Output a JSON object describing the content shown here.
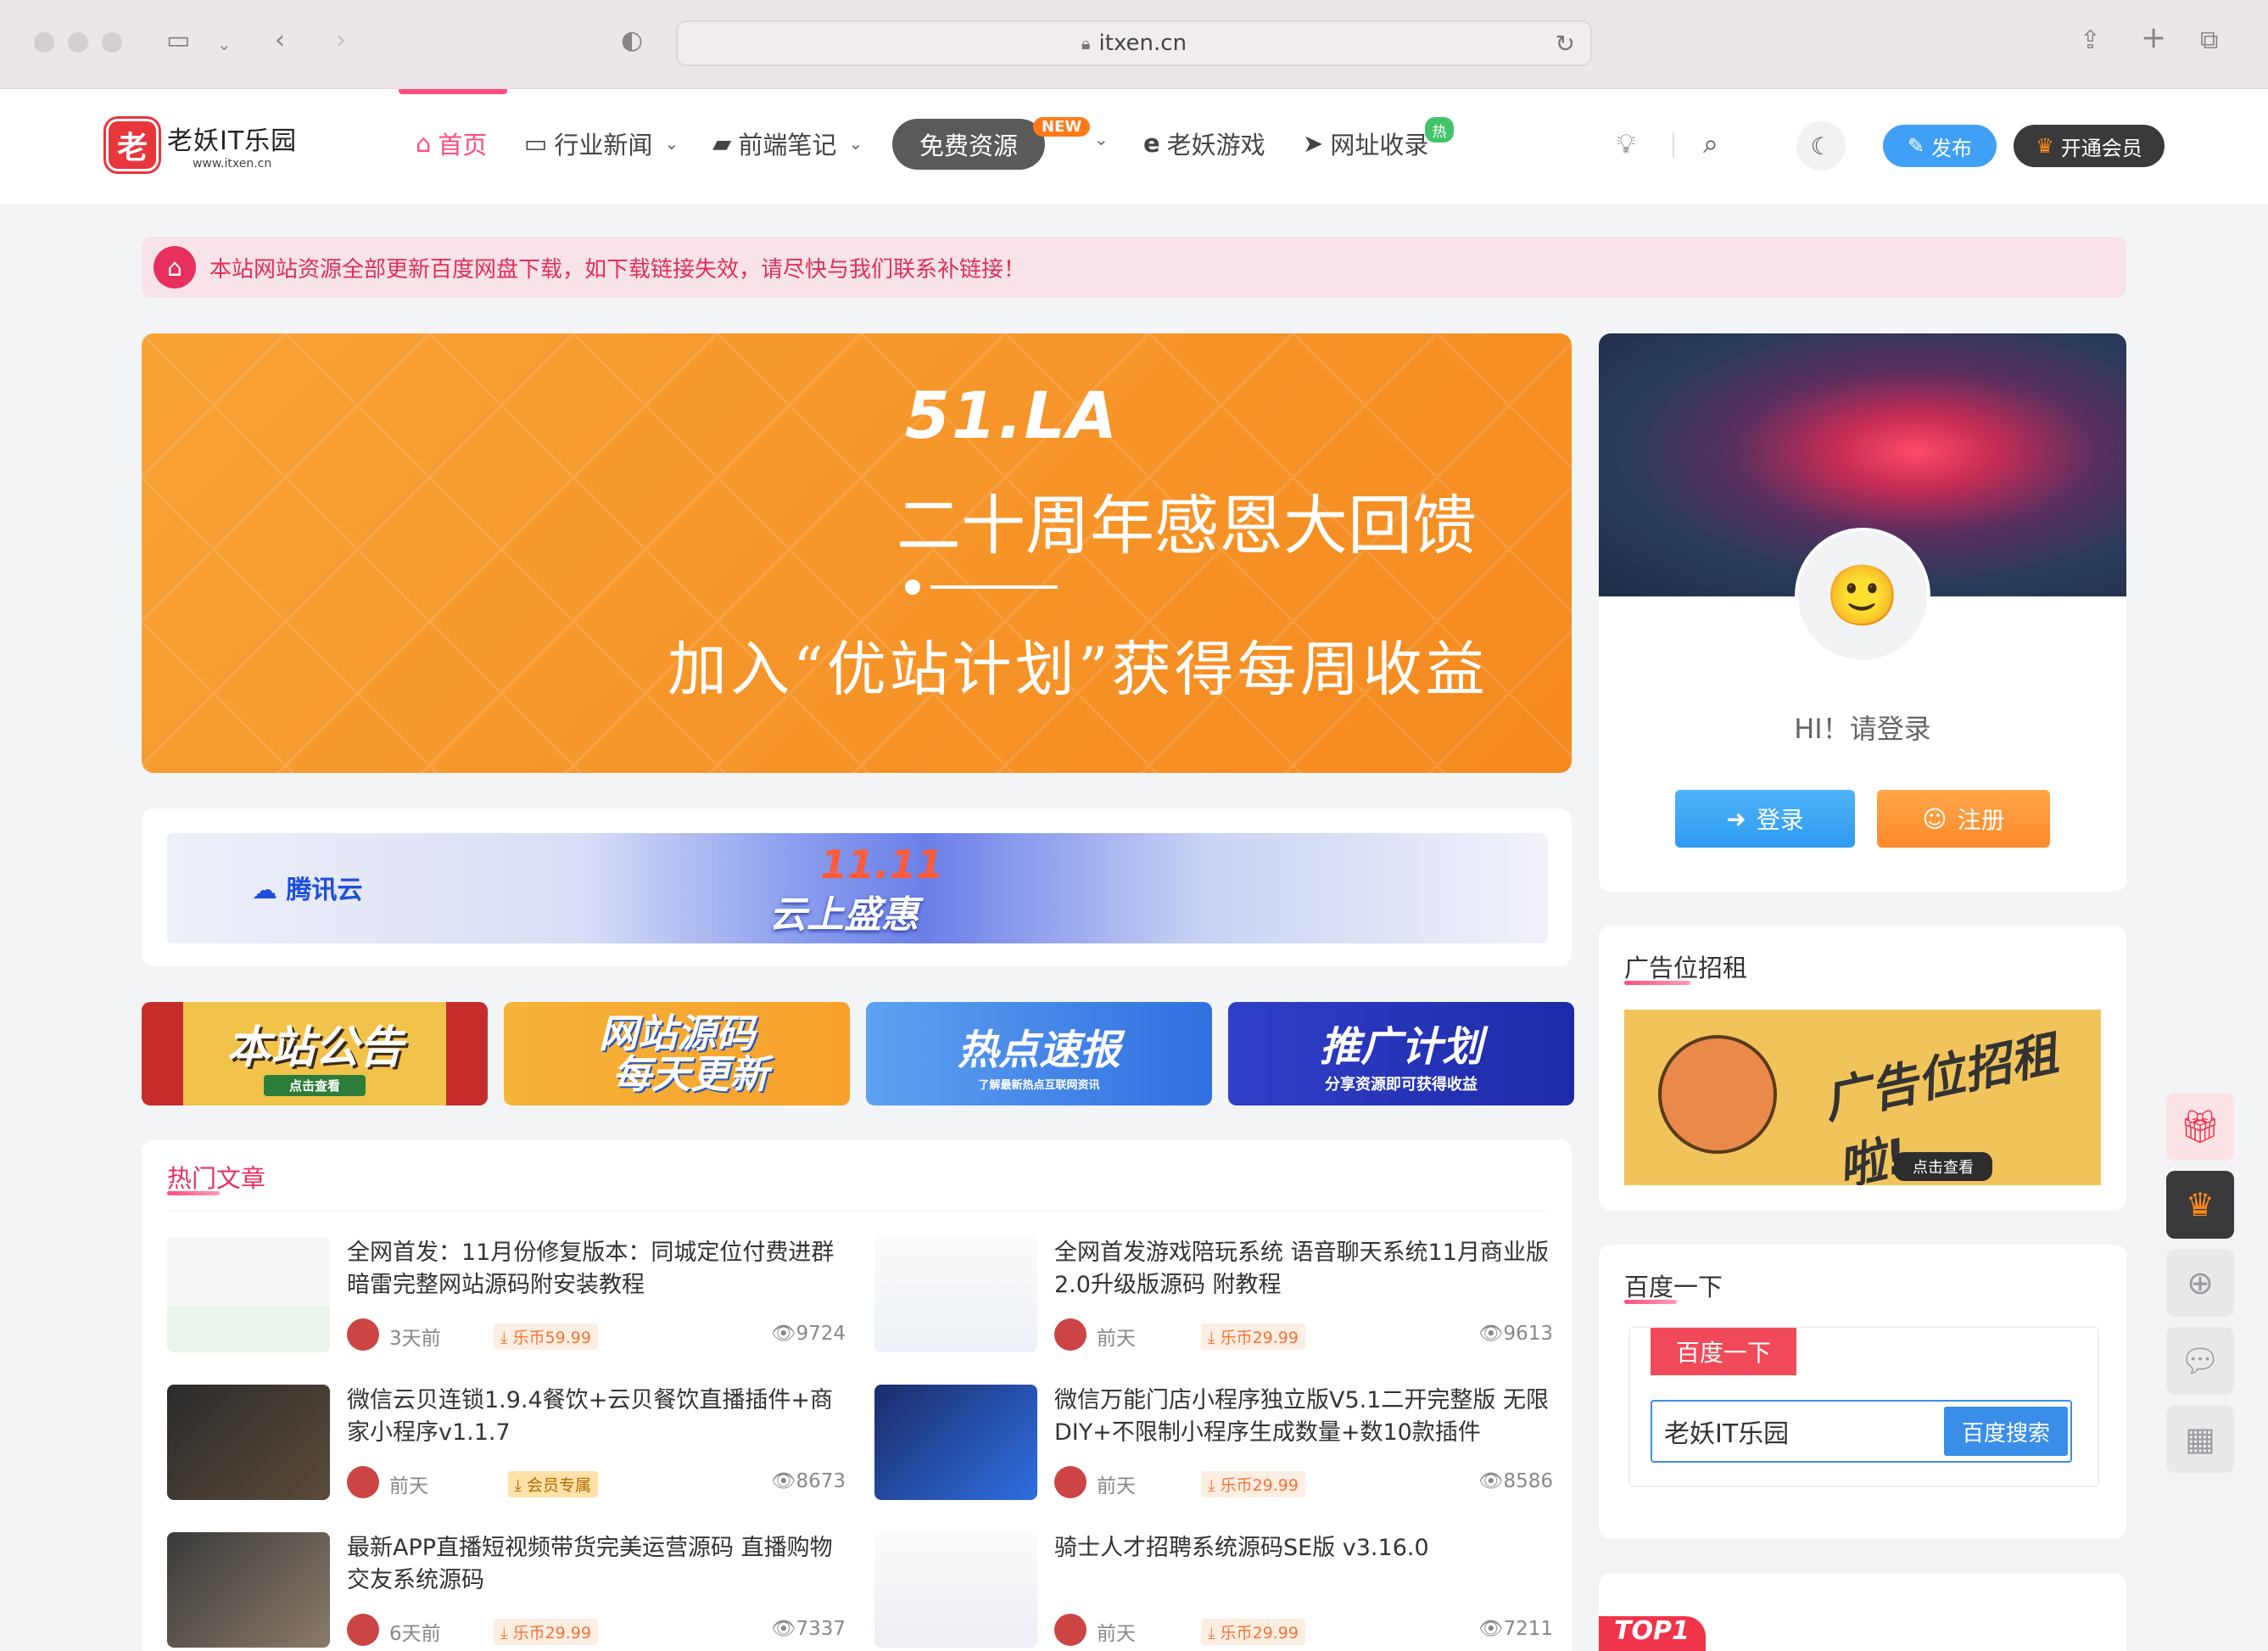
{
  "browser": {
    "url": "itxen.cn"
  },
  "site": {
    "logo_char": "老",
    "logo_name": "老妖IT乐园",
    "logo_domain": "www.itxen.cn"
  },
  "nav": [
    {
      "label": "首页",
      "icon": "home-icon"
    },
    {
      "label": "行业新闻",
      "icon": "monitor-icon"
    },
    {
      "label": "前端笔记",
      "icon": "book-icon"
    },
    {
      "label": "免费资源",
      "badge": "NEW"
    },
    {
      "label": "老妖游戏",
      "icon": "edge-icon"
    },
    {
      "label": "网址收录",
      "icon": "telegram-icon",
      "badge": "热"
    }
  ],
  "header_actions": {
    "publish": "发布",
    "vip": "开通会员"
  },
  "notice": "本站网站资源全部更新百度网盘下载，如下载链接失效，请尽快与我们联系补链接！",
  "banner_main": {
    "brand": "51.LA",
    "line1": "二十周年感恩大回馈",
    "line2": "加入“优站计划”获得每周收益"
  },
  "banner_tencent": {
    "logo": "腾讯云",
    "title": "云上盛惠",
    "date": "11.11"
  },
  "small_banners": [
    {
      "title": "本站公告",
      "sub": "点击查看"
    },
    {
      "title": "网站源码\n每天更新",
      "sub": ""
    },
    {
      "title": "热点速报",
      "sub": "了解最新热点互联网资讯"
    },
    {
      "title": "推广计划",
      "sub": "分享资源即可获得收益"
    }
  ],
  "hot": {
    "title": "热门文章",
    "articles": [
      {
        "title": "全网首发：11月份修复版本：同城定位付费进群暗雷完整网站源码附安装教程",
        "time": "3天前",
        "price": "乐币59.99",
        "views": "9724"
      },
      {
        "title": "全网首发游戏陪玩系统 语音聊天系统11月商业版2.0升级版源码 附教程",
        "time": "前天",
        "price": "乐币29.99",
        "views": "9613"
      },
      {
        "title": "微信云贝连锁1.9.4餐饮+云贝餐饮直播插件+商家小程序v1.1.7",
        "time": "前天",
        "price": "会员专属",
        "views": "8673"
      },
      {
        "title": "微信万能门店小程序独立版V5.1二开完整版 无限DIY+不限制小程序生成数量+数10款插件",
        "time": "前天",
        "price": "乐币29.99",
        "views": "8586"
      },
      {
        "title": "最新APP直播短视频带货完美运营源码 直播购物交友系统源码",
        "time": "6天前",
        "price": "乐币29.99",
        "views": "7337"
      },
      {
        "title": "骑士人才招聘系统源码SE版 v3.16.0",
        "time": "前天",
        "price": "乐币29.99",
        "views": "7211"
      }
    ]
  },
  "user": {
    "greeting": "HI！请登录",
    "login": "登录",
    "register": "注册"
  },
  "ad": {
    "title": "广告位招租",
    "image_text": "广告位招租啦!",
    "image_button": "点击查看"
  },
  "baidu": {
    "title": "百度一下",
    "tab": "百度一下",
    "input_value": "老妖IT乐园",
    "button": "百度搜索"
  },
  "top_badge": "TOP1",
  "colors": {
    "accent": "#ff4d7f",
    "notice_bg": "#f7e3e8",
    "banner_orange": "#f8a235",
    "login_blue": "#3fa0f5",
    "register_orange": "#ff8a2a"
  }
}
